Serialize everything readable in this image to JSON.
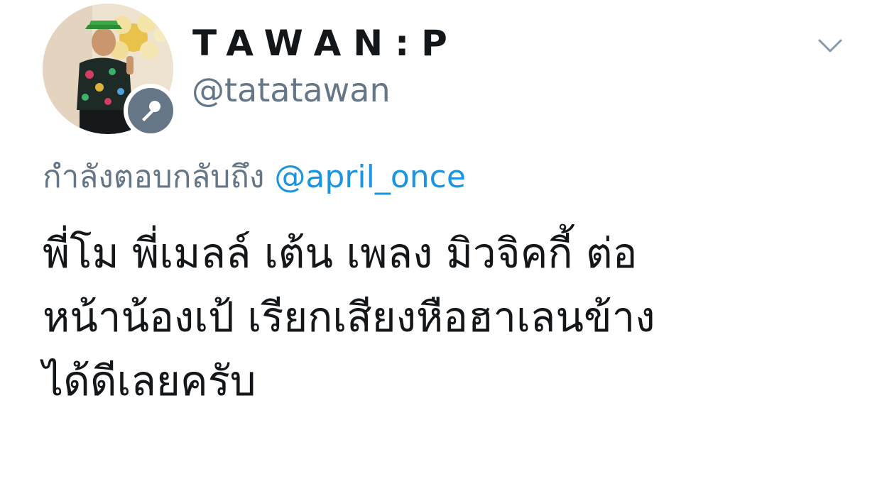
{
  "tweet": {
    "display_name": "TAWAN:P",
    "handle": "@tatatawan",
    "reply_prefix": "กำลังตอบกลับถึง",
    "reply_mention": "@april_once",
    "text_lines": [
      "พี่โม พี่เมลล์ เต้น เพลง มิวจิคกี้ ต่อ",
      "หน้าน้องเป้  เรียกเสียงหือฮาเลนข้าง",
      "ได้ดีเลยครับ"
    ]
  },
  "icons": {
    "avatar": "profile-photo",
    "badge": "microphone-icon",
    "menu": "chevron-down-icon"
  },
  "colors": {
    "primary_text": "#14171a",
    "secondary_text": "#657786",
    "link": "#1b95e0",
    "badge_background": "#657786",
    "background": "#ffffff"
  }
}
